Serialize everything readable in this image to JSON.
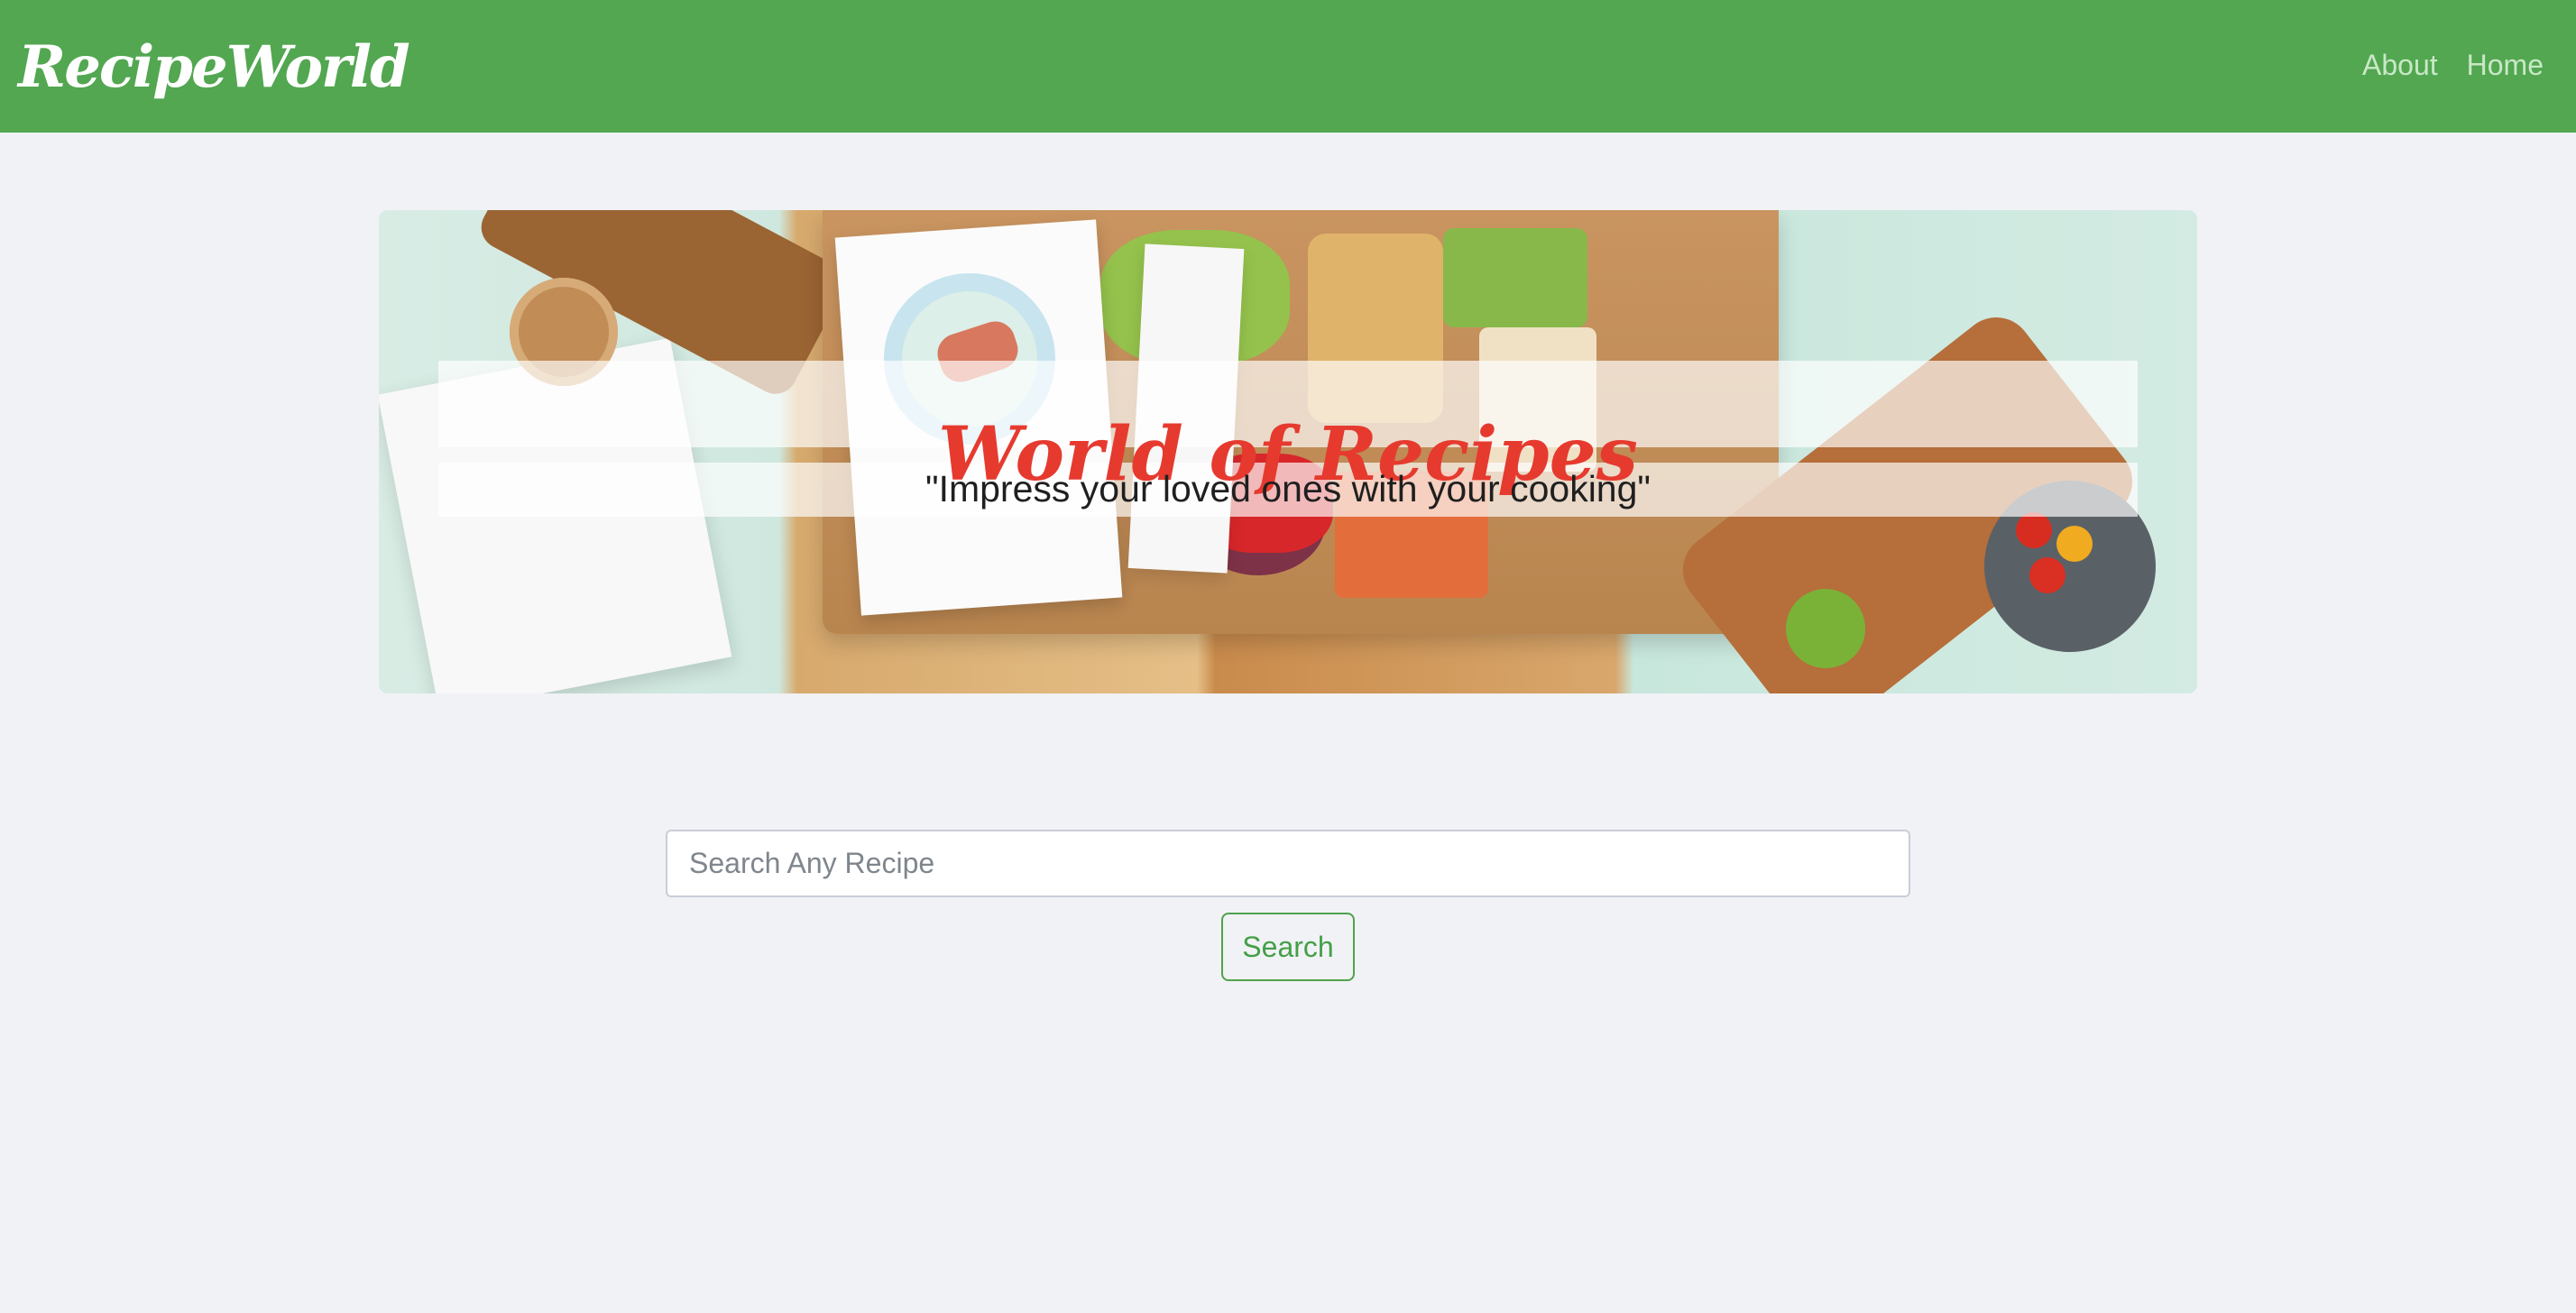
{
  "navbar": {
    "brand": "RecipeWorld",
    "links": [
      {
        "label": "About"
      },
      {
        "label": "Home"
      }
    ]
  },
  "banner": {
    "title": "World of Recipes",
    "subtitle": "\"Impress your loved ones with your cooking\""
  },
  "search": {
    "placeholder": "Search Any Recipe",
    "value": "",
    "button_label": "Search"
  },
  "colors": {
    "navbar_bg": "#52a750",
    "page_bg": "#f1f2f6",
    "title_red": "#e63a2f",
    "button_green": "#43a047"
  },
  "icons": []
}
